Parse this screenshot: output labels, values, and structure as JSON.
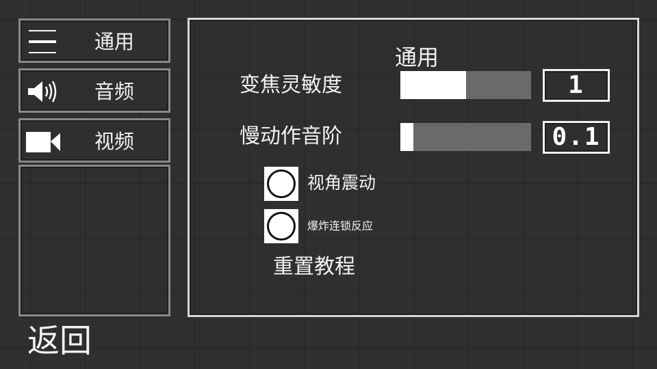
{
  "sidebar": {
    "items": [
      {
        "label": "通用",
        "icon": "menu-icon"
      },
      {
        "label": "音频",
        "icon": "speaker-icon"
      },
      {
        "label": "视频",
        "icon": "video-camera-icon"
      }
    ]
  },
  "panel": {
    "title": "通用",
    "zoom_sensitivity": {
      "label": "变焦灵敏度",
      "value": "1",
      "slider_fraction": 0.5
    },
    "slowmo_step": {
      "label": "慢动作音阶",
      "value": "0.1",
      "slider_fraction": 0.1
    },
    "camera_shake": {
      "label": "视角震动",
      "checked": false
    },
    "chain_reaction": {
      "label": "爆炸连锁反应",
      "checked": false
    },
    "reset_tutorial": "重置教程"
  },
  "back": "返回",
  "colors": {
    "background": "#2f2f2f",
    "slider_fill": "#ffffff",
    "slider_track": "#6a6a6a",
    "border_light": "#d8d8d8"
  }
}
